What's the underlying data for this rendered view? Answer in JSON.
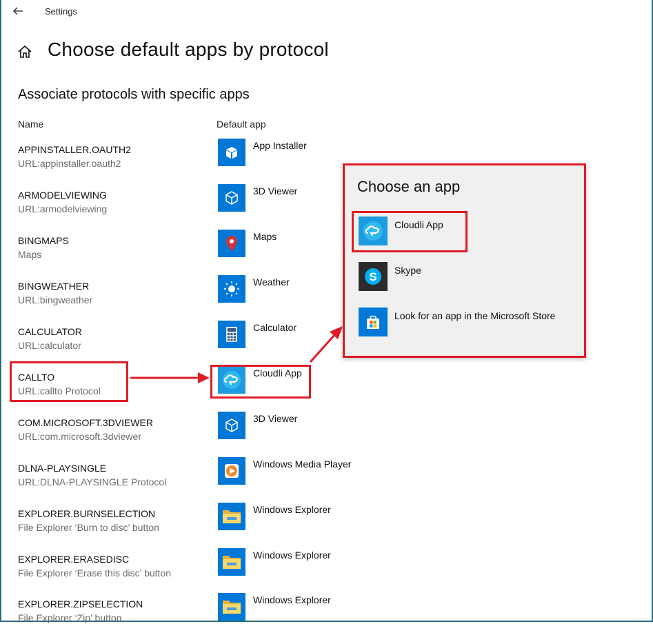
{
  "window": {
    "title": "Settings"
  },
  "page": {
    "title": "Choose default apps by protocol",
    "section_title": "Associate protocols with specific apps"
  },
  "columns": {
    "name": "Name",
    "default_app": "Default app"
  },
  "rows": [
    {
      "name": "APPINSTALLER.OAUTH2",
      "desc": "URL:appinstaller.oauth2",
      "app": "App Installer",
      "icon": "package-icon"
    },
    {
      "name": "ARMODELVIEWING",
      "desc": "URL:armodelviewing",
      "app": "3D Viewer",
      "icon": "cube-icon"
    },
    {
      "name": "BINGMAPS",
      "desc": "Maps",
      "app": "Maps",
      "icon": "map-pin-icon"
    },
    {
      "name": "BINGWEATHER",
      "desc": "URL:bingweather",
      "app": "Weather",
      "icon": "sun-icon"
    },
    {
      "name": "CALCULATOR",
      "desc": "URL:calculator",
      "app": "Calculator",
      "icon": "calculator-icon"
    },
    {
      "name": "CALLTO",
      "desc": "URL:callto Protocol",
      "app": "Cloudli App",
      "icon": "cloudli-icon"
    },
    {
      "name": "COM.MICROSOFT.3DVIEWER",
      "desc": "URL:com.microsoft.3dviewer",
      "app": "3D Viewer",
      "icon": "cube-icon"
    },
    {
      "name": "DLNA-PLAYSINGLE",
      "desc": "URL:DLNA-PLAYSINGLE Protocol",
      "app": "Windows Media Player",
      "icon": "media-player-icon"
    },
    {
      "name": "EXPLORER.BURNSELECTION",
      "desc": "File Explorer ‘Burn to disc’ button",
      "app": "Windows Explorer",
      "icon": "folder-icon"
    },
    {
      "name": "EXPLORER.ERASEDISC",
      "desc": "File Explorer ‘Erase this disc’ button",
      "app": "Windows Explorer",
      "icon": "folder-icon"
    },
    {
      "name": "EXPLORER.ZIPSELECTION",
      "desc": "File Explorer ‘Zip’ button",
      "app": "Windows Explorer",
      "icon": "folder-icon"
    }
  ],
  "popup": {
    "title": "Choose an app",
    "items": [
      {
        "label": "Cloudli App",
        "icon": "cloudli-icon"
      },
      {
        "label": "Skype",
        "icon": "skype-icon"
      },
      {
        "label": "Look for an app in the Microsoft Store",
        "icon": "store-icon"
      }
    ]
  },
  "colors": {
    "accent": "#0078d7",
    "highlight": "#e01b24",
    "popup_bg": "#f0f0f0",
    "secondary_text": "#6b6b6b"
  }
}
